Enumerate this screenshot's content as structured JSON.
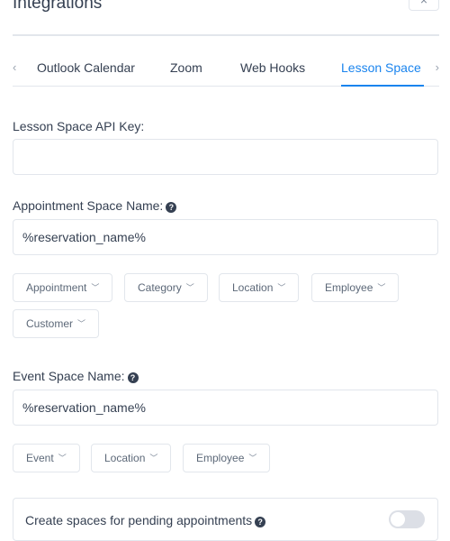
{
  "header": {
    "title": "Integrations",
    "close_label": "×"
  },
  "tabs": {
    "prev_label": "‹",
    "next_label": "›",
    "items": [
      {
        "label": "Outlook Calendar",
        "active": false
      },
      {
        "label": "Zoom",
        "active": false
      },
      {
        "label": "Web Hooks",
        "active": false
      },
      {
        "label": "Lesson Space",
        "active": true
      }
    ]
  },
  "api_key": {
    "label": "Lesson Space API Key:",
    "value": ""
  },
  "appointment_space": {
    "label": "Appointment Space Name:",
    "value": "%reservation_name%",
    "placeholders": [
      "Appointment",
      "Category",
      "Location",
      "Employee",
      "Customer"
    ]
  },
  "event_space": {
    "label": "Event Space Name:",
    "value": "%reservation_name%",
    "placeholders": [
      "Event",
      "Location",
      "Employee"
    ]
  },
  "pending": {
    "label": "Create spaces for pending appointments",
    "enabled": false
  },
  "icons": {
    "help": "?",
    "chevron": "﹀"
  },
  "colors": {
    "accent": "#1a84ee",
    "text": "#354052",
    "border": "#e2e6ec"
  }
}
